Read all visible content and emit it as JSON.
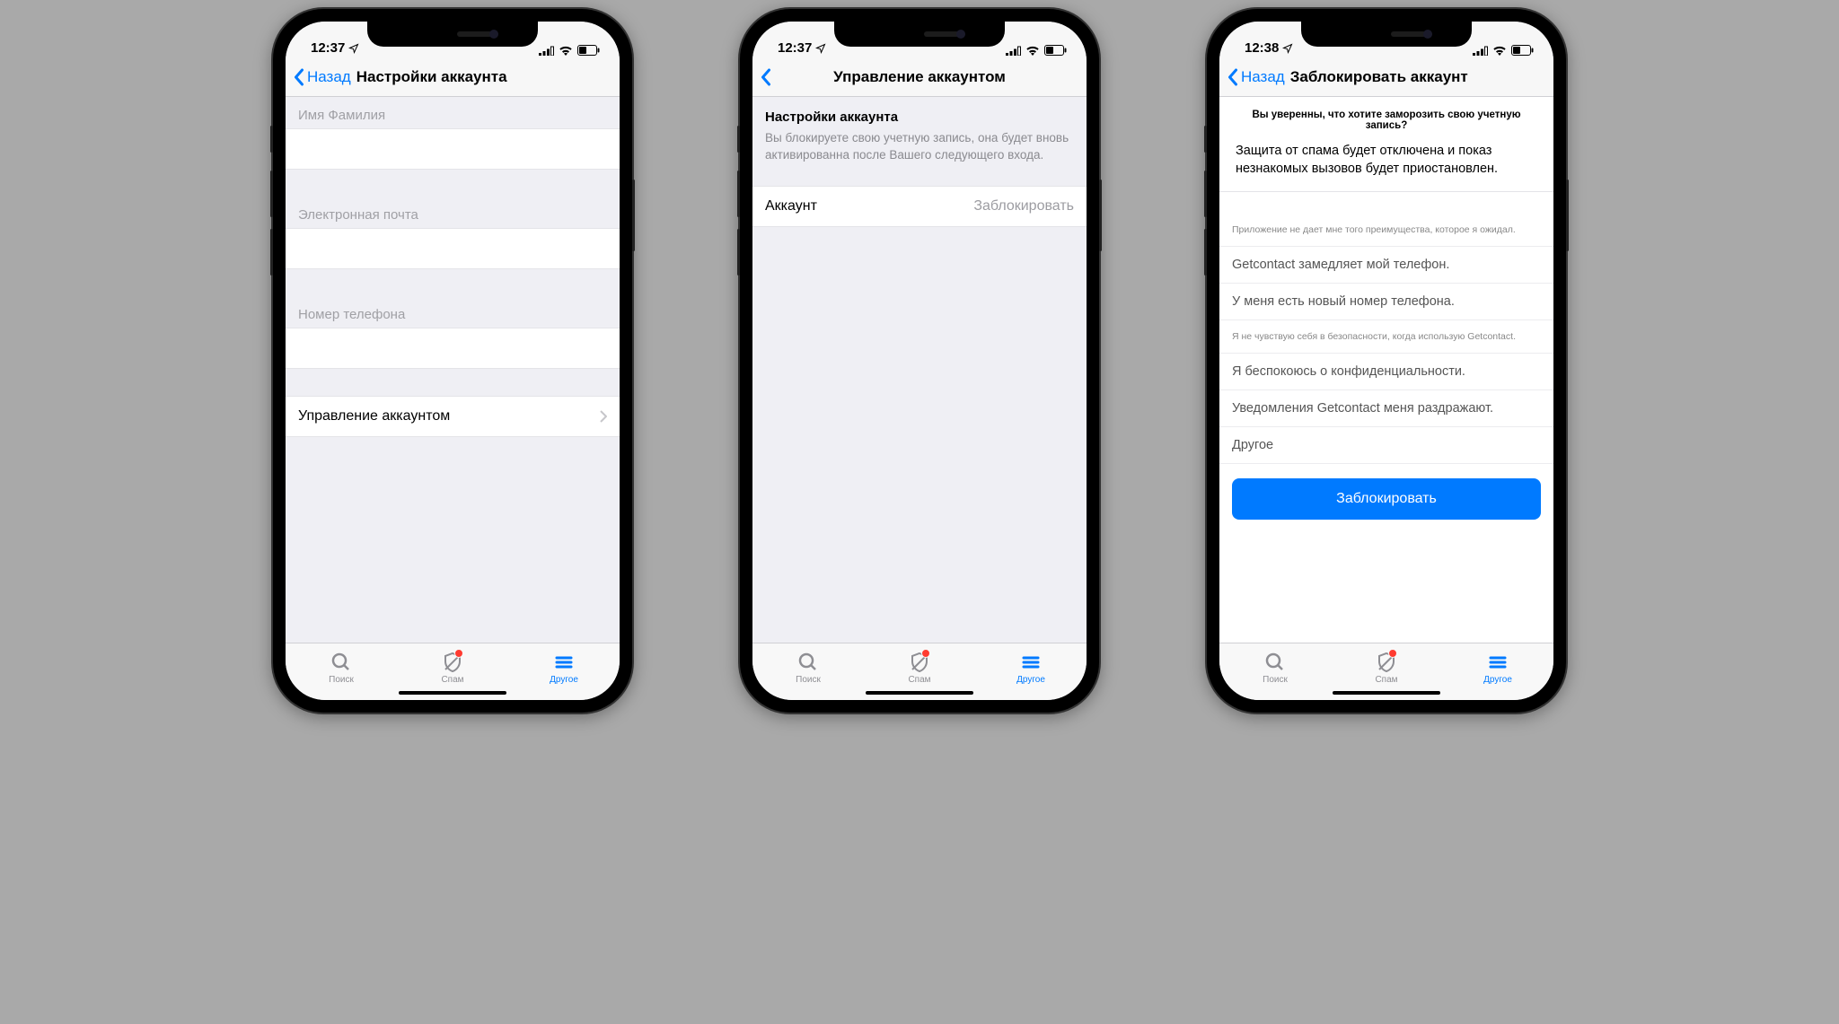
{
  "status": {
    "time_a": "12:37",
    "time_b": "12:37",
    "time_c": "12:38"
  },
  "nav": {
    "back": "Назад",
    "title1": "Настройки аккаунта",
    "title2": "Управление аккаунтом",
    "title3": "Заблокировать аккаунт"
  },
  "s1": {
    "name_ph": "Имя Фамилия",
    "email_ph": "Электронная почта",
    "phone_ph": "Номер телефона",
    "manage": "Управление аккаунтом"
  },
  "s2": {
    "heading": "Настройки аккаунта",
    "desc": "Вы блокируете свою учетную запись, она будет вновь активированна после Вашего следующего входа.",
    "row_label": "Аккаунт",
    "row_action": "Заблокировать"
  },
  "s3": {
    "question": "Вы уверенны, что хотите заморозить свою учетную запись?",
    "message": "Защита от спама будет отключена и показ незнакомых вызовов будет приостановлен.",
    "reasons": [
      "Приложение не дает мне того преимущества, которое я ожидал.",
      "Getcontact замедляет мой телефон.",
      "У меня есть новый номер телефона.",
      "Я не чувствую себя в безопасности, когда использую Getcontact.",
      "Я беспокоюсь о конфиденциальности.",
      "Уведомления Getcontact меня раздражают.",
      "Другое"
    ],
    "button": "Заблокировать"
  },
  "tabs": {
    "search": "Поиск",
    "spam": "Спам",
    "other": "Другое"
  }
}
